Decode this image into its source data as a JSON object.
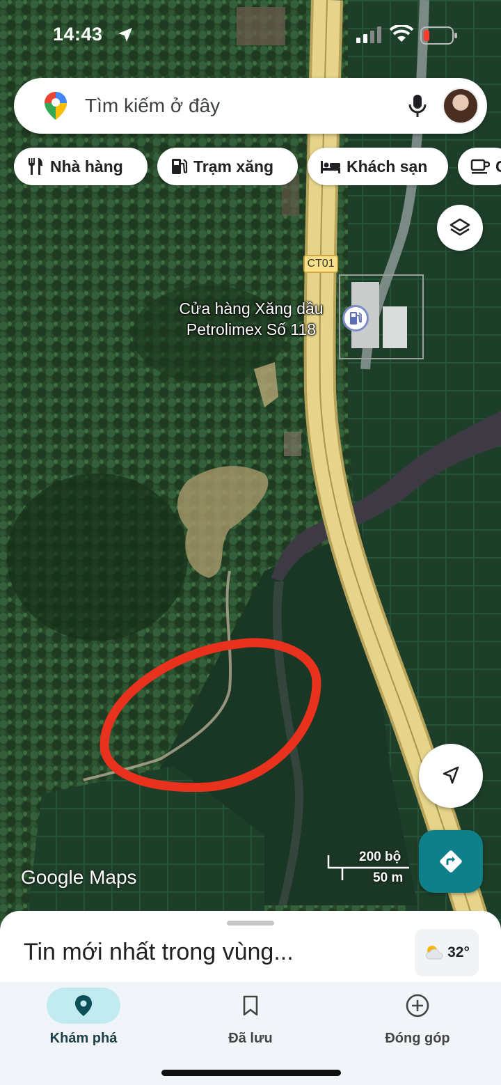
{
  "status_bar": {
    "time": "14:43"
  },
  "search": {
    "placeholder": "Tìm kiếm ở đây"
  },
  "chips": [
    "Nhà hàng",
    "Trạm xăng",
    "Khách sạn",
    "C"
  ],
  "map": {
    "road_shield": "CT01",
    "poi_line1": "Cửa hàng Xăng dầu",
    "poi_line2": "Petrolimex Số 118",
    "watermark": "Google Maps",
    "scale_ft": "200 bộ",
    "scale_m": "50 m"
  },
  "sheet": {
    "title": "Tin mới nhất trong vùng...",
    "temperature": "32°"
  },
  "bottom_nav": [
    {
      "label": "Khám phá",
      "icon": "location-pin-icon",
      "active": true
    },
    {
      "label": "Đã lưu",
      "icon": "bookmark-icon",
      "active": false
    },
    {
      "label": "Đóng góp",
      "icon": "add-circle-icon",
      "active": false
    }
  ],
  "colors": {
    "accent": "#0f7f8a",
    "nav_active": "#c2ebf0",
    "highlight_circle": "#e8321e"
  }
}
